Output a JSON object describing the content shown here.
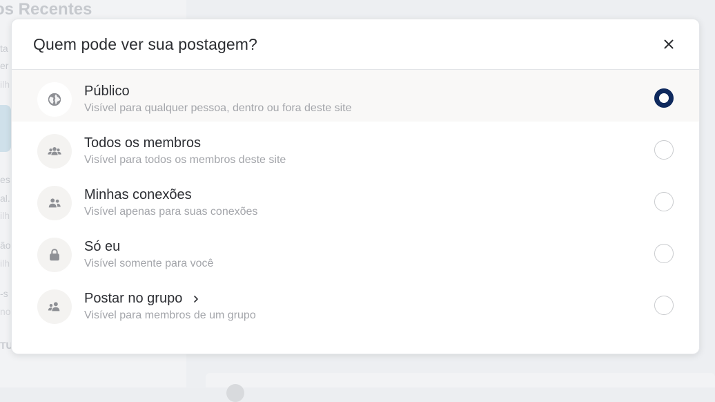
{
  "background": {
    "heading": "os Recentes",
    "fragments": [
      "ta",
      "er",
      "ilh",
      "es",
      "al.",
      "ilh",
      "ão",
      "ilh",
      "-s",
      "no",
      "TU"
    ]
  },
  "modal": {
    "title": "Quem pode ver sua postagem?",
    "close_icon": "close-icon",
    "options": [
      {
        "id": "public",
        "title": "Público",
        "description": "Visível para qualquer pessoa, dentro ou fora deste site",
        "icon": "globe-icon",
        "selected": true
      },
      {
        "id": "all-members",
        "title": "Todos os membros",
        "description": "Visível para todos os membros deste site",
        "icon": "group-icon",
        "selected": false
      },
      {
        "id": "connections",
        "title": "Minhas conexões",
        "description": "Visível apenas para suas conexões",
        "icon": "people-icon",
        "selected": false
      },
      {
        "id": "only-me",
        "title": "Só eu",
        "description": "Visível somente para você",
        "icon": "lock-icon",
        "selected": false
      },
      {
        "id": "group",
        "title": "Postar no grupo",
        "description": "Visível para membros de um grupo",
        "icon": "user-group-icon",
        "has_chevron": true,
        "selected": false
      }
    ],
    "colors": {
      "radio_checked": "#0f2a5e",
      "selected_row_bg": "#f9f8f7"
    }
  }
}
